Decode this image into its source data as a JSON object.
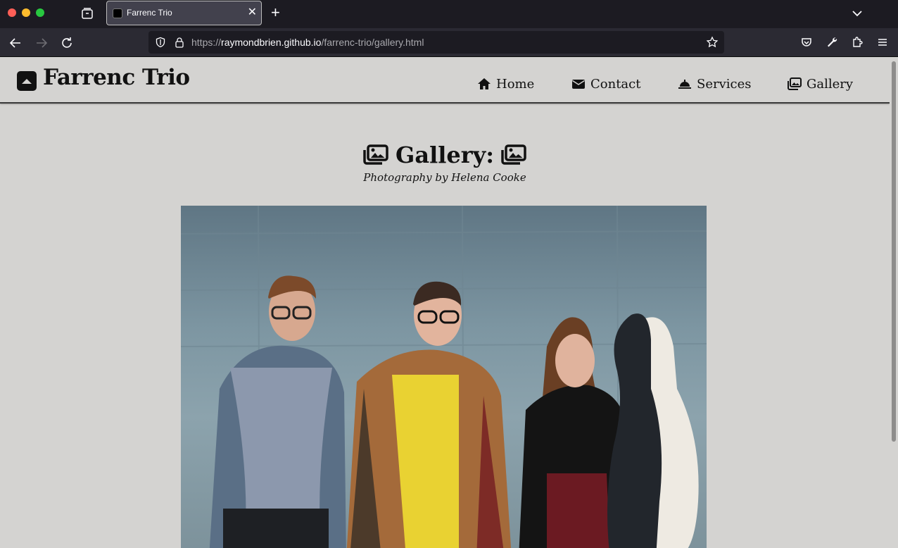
{
  "browser": {
    "tab_title": "Farrenc Trio",
    "url_prefix": "https://",
    "url_host": "raymondbrien.github.io",
    "url_path": "/farrenc-trio/gallery.html",
    "icons": [
      "tab-overview-icon",
      "close-icon",
      "plus-icon",
      "chevron-down-icon",
      "back-icon",
      "forward-icon",
      "reload-icon",
      "shield-icon",
      "lock-icon",
      "star-icon",
      "pocket-icon",
      "wrench-icon",
      "extensions-icon",
      "menu-icon"
    ]
  },
  "site": {
    "title": "Farrenc Trio",
    "logo_icon": "caret-up-square-icon",
    "nav": [
      {
        "label": "Home",
        "icon": "home-icon"
      },
      {
        "label": "Contact",
        "icon": "envelope-icon"
      },
      {
        "label": "Services",
        "icon": "bell-concierge-icon"
      },
      {
        "label": "Gallery",
        "icon": "images-icon"
      }
    ]
  },
  "main": {
    "heading": "Gallery:",
    "subheading": "Photography by Helena Cooke",
    "photo_alt": "three musicians standing in front of a blue-grey wall, one holding a cello case"
  },
  "colors": {
    "page_bg": "#d4d3d1",
    "chrome_bg": "#1c1b22",
    "toolbar_bg": "#2b2a33",
    "text": "#111111"
  }
}
